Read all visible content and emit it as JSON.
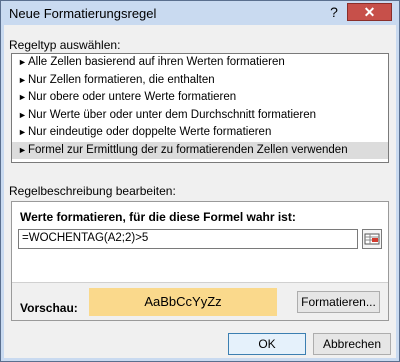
{
  "window": {
    "title": "Neue Formatierungsregel"
  },
  "titlebar": {
    "help_label": "?",
    "close_label": "✕"
  },
  "rule_type": {
    "label": "Regeltyp auswählen:",
    "items": [
      "Alle Zellen basierend auf ihren Werten formatieren",
      "Nur Zellen formatieren, die enthalten",
      "Nur obere oder untere Werte formatieren",
      "Nur Werte über oder unter dem Durchschnitt formatieren",
      "Nur eindeutige oder doppelte Werte formatieren",
      "Formel zur Ermittlung der zu formatierenden Zellen verwenden"
    ],
    "selected_index": 5
  },
  "rule_description": {
    "label": "Regelbeschreibung bearbeiten:",
    "formula_label": "Werte formatieren, für die diese Formel wahr ist:",
    "formula_value": "=WOCHENTAG(A2;2)>5",
    "preview_label": "Vorschau:",
    "preview_text": "AaBbCcYyZz",
    "preview_color": "#fad98c",
    "format_button_label": "Formatieren..."
  },
  "buttons": {
    "ok": "OK",
    "cancel": "Abbrechen"
  }
}
